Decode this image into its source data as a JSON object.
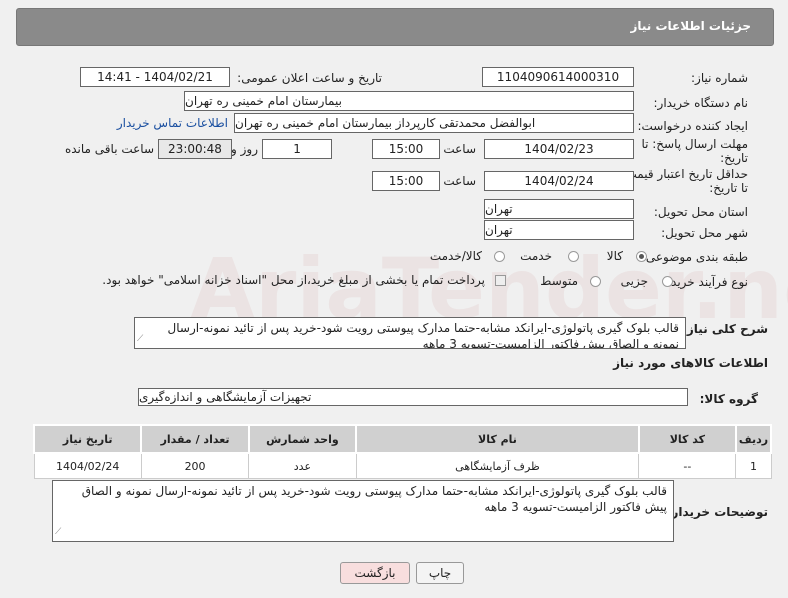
{
  "header": {
    "title": "جزئیات اطلاعات نیاز"
  },
  "fields": {
    "need_number_label": "شماره نیاز:",
    "need_number": "1104090614000310",
    "announce_label": "تاریخ و ساعت اعلان عمومی:",
    "announce_value": "1404/02/21 - 14:41",
    "buyer_org_label": "نام دستگاه خریدار:",
    "buyer_org": "بیمارستان امام خمینی ره  تهران",
    "creator_label": "ایجاد کننده درخواست:",
    "creator": "ابوالفضل محمدتقی کارپرداز بیمارستان امام خمینی ره  تهران",
    "contact_link": "اطلاعات تماس خریدار",
    "deadline_label_1": "مهلت ارسال پاسخ: تا",
    "deadline_label_2": "تاریخ:",
    "deadline_date": "1404/02/23",
    "time_label": "ساعت",
    "deadline_time": "15:00",
    "days_value": "1",
    "days_label": "روز و",
    "remaining_time": "23:00:48",
    "remaining_label": "ساعت باقی مانده",
    "validity_label_1": "حداقل تاریخ اعتبار قیمت:",
    "validity_label_2": "تا تاریخ:",
    "validity_date": "1404/02/24",
    "validity_time": "15:00",
    "province_label": "استان محل تحویل:",
    "province": "تهران",
    "city_label": "شهر محل تحویل:",
    "city": "تهران",
    "category_label": "طبقه بندی موضوعی:",
    "category_options": [
      "کالا",
      "خدمت",
      "کالا/خدمت"
    ],
    "process_label": "نوع فرآیند خرید :",
    "process_options": [
      "جزیی",
      "متوسط"
    ],
    "payment_note": "پرداخت تمام یا بخشی از مبلغ خرید،از محل \"اسناد خزانه اسلامی\" خواهد بود.",
    "summary_label": "شرح کلی نیاز:",
    "summary": "قالب بلوک گیری پاتولوژی-ایرانکد مشابه-حتما مدارک پیوستی رویت شود-خرید پس از تائید نمونه-ارسال نمونه و الصاق پیش فاکتور الزامیست-تسویه 3 ماهه",
    "goods_info_title": "اطلاعات کالاهای مورد نیاز",
    "goods_group_label": "گروه کالا:",
    "goods_group": "تجهیزات آزمایشگاهی و اندازه‌گیری",
    "buyer_notes_label": "توضیحات خریدار:",
    "buyer_notes": "قالب بلوک گیری پاتولوژی-ایرانکد مشابه-حتما مدارک پیوستی رویت شود-خرید پس از تائید نمونه-ارسال نمونه و الصاق پیش فاکتور الزامیست-تسویه 3 ماهه"
  },
  "table": {
    "headers": [
      "ردیف",
      "کد کالا",
      "نام کالا",
      "واحد شمارش",
      "تعداد / مقدار",
      "تاریخ نیاز"
    ],
    "rows": [
      [
        "1",
        "--",
        "ظرف آزمایشگاهی",
        "عدد",
        "200",
        "1404/02/24"
      ]
    ]
  },
  "buttons": {
    "print": "چاپ",
    "back": "بازگشت"
  },
  "watermark": "AriaTender.neT"
}
